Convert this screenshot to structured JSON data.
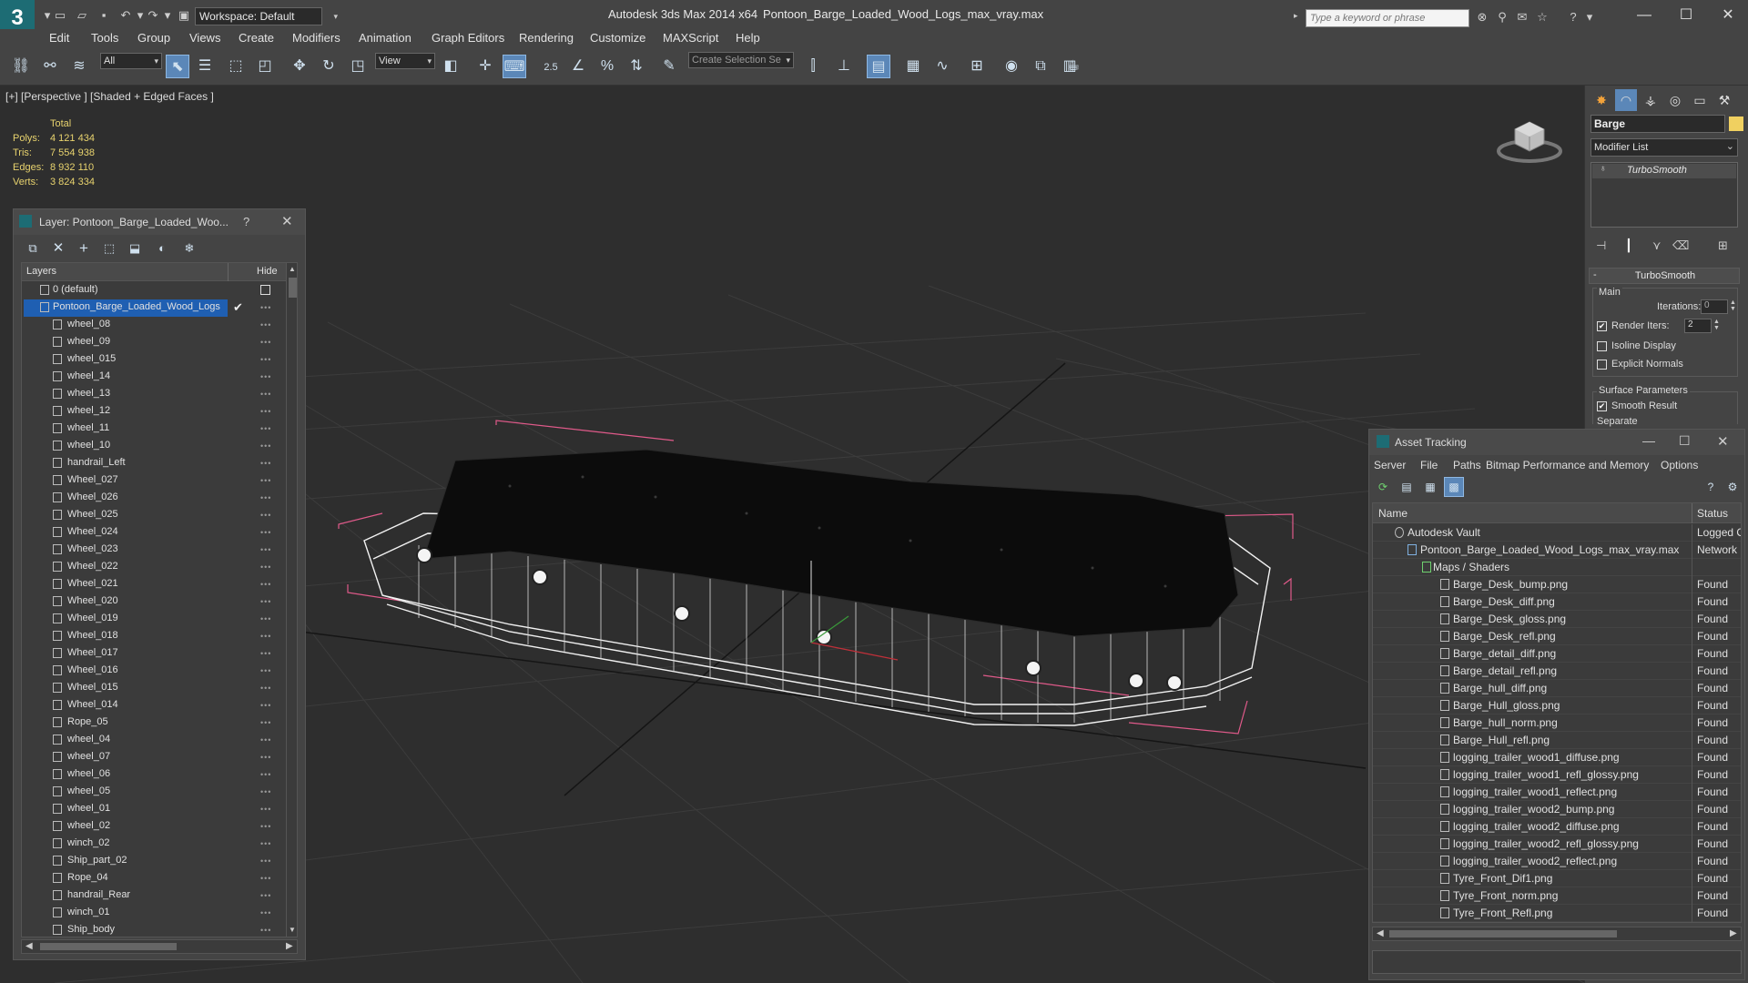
{
  "titlebar": {
    "workspace": "Workspace: Default",
    "app_title": "Autodesk 3ds Max  2014 x64",
    "file_title": "Pontoon_Barge_Loaded_Wood_Logs_max_vray.max",
    "search_placeholder": "Type a keyword or phrase"
  },
  "menu": [
    "Edit",
    "Tools",
    "Group",
    "Views",
    "Create",
    "Modifiers",
    "Animation",
    "Graph Editors",
    "Rendering",
    "Customize",
    "MAXScript",
    "Help"
  ],
  "toolbar": {
    "selection_filter": "All",
    "reference_coord": "View",
    "snap_value": "2.5",
    "named_selection_placeholder": "Create Selection Se"
  },
  "viewport": {
    "label": "[+] [Perspective ] [Shaded + Edged Faces ]",
    "stats": {
      "header": "Total",
      "rows": [
        {
          "k": "Polys:",
          "v": "4 121 434"
        },
        {
          "k": "Tris:",
          "v": "7 554 938"
        },
        {
          "k": "Edges:",
          "v": "8 932 110"
        },
        {
          "k": "Verts:",
          "v": "3 824 334"
        }
      ]
    }
  },
  "layer_panel": {
    "title": "Layer: Pontoon_Barge_Loaded_Woo...",
    "help": "?",
    "col_layers": "Layers",
    "col_hide": "Hide",
    "default_layer": "0 (default)",
    "active_layer": "Pontoon_Barge_Loaded_Wood_Logs",
    "items": [
      "wheel_08",
      "wheel_09",
      "wheel_015",
      "wheel_14",
      "wheel_13",
      "wheel_12",
      "wheel_11",
      "wheel_10",
      "handrail_Left",
      "Wheel_027",
      "Wheel_026",
      "Wheel_025",
      "Wheel_024",
      "Wheel_023",
      "Wheel_022",
      "Wheel_021",
      "Wheel_020",
      "Wheel_019",
      "Wheel_018",
      "Wheel_017",
      "Wheel_016",
      "Wheel_015",
      "Wheel_014",
      "Rope_05",
      "wheel_04",
      "wheel_07",
      "wheel_06",
      "wheel_05",
      "wheel_01",
      "wheel_02",
      "winch_02",
      "Ship_part_02",
      "Rope_04",
      "handrail_Rear",
      "winch_01",
      "Ship_body"
    ]
  },
  "command_panel": {
    "object_name": "Barge",
    "modifier_list": "Modifier List",
    "stack_item": "TurboSmooth",
    "rollout_title": "TurboSmooth",
    "main_group": "Main",
    "iterations_label": "Iterations:",
    "iterations_value": "0",
    "render_iters_label": "Render Iters:",
    "render_iters_value": "2",
    "isoline_label": "Isoline Display",
    "explicit_normals_label": "Explicit Normals",
    "surface_group": "Surface Parameters",
    "smooth_result_label": "Smooth Result",
    "separate_label": "Separate"
  },
  "asset_panel": {
    "title": "Asset Tracking",
    "menu": [
      "Server",
      "File",
      "Paths",
      "Bitmap Performance and Memory",
      "Options"
    ],
    "col_name": "Name",
    "col_status": "Status",
    "vault": {
      "name": "Autodesk Vault",
      "status": "Logged O"
    },
    "file": {
      "name": "Pontoon_Barge_Loaded_Wood_Logs_max_vray.max",
      "status": "Network"
    },
    "maps_group": "Maps / Shaders",
    "maps": [
      {
        "name": "Barge_Desk_bump.png",
        "status": "Found"
      },
      {
        "name": "Barge_Desk_diff.png",
        "status": "Found"
      },
      {
        "name": "Barge_Desk_gloss.png",
        "status": "Found"
      },
      {
        "name": "Barge_Desk_refl.png",
        "status": "Found"
      },
      {
        "name": "Barge_detail_diff.png",
        "status": "Found"
      },
      {
        "name": "Barge_detail_refl.png",
        "status": "Found"
      },
      {
        "name": "Barge_hull_diff.png",
        "status": "Found"
      },
      {
        "name": "Barge_Hull_gloss.png",
        "status": "Found"
      },
      {
        "name": "Barge_hull_norm.png",
        "status": "Found"
      },
      {
        "name": "Barge_Hull_refl.png",
        "status": "Found"
      },
      {
        "name": "logging_trailer_wood1_diffuse.png",
        "status": "Found"
      },
      {
        "name": "logging_trailer_wood1_refl_glossy.png",
        "status": "Found"
      },
      {
        "name": "logging_trailer_wood1_reflect.png",
        "status": "Found"
      },
      {
        "name": "logging_trailer_wood2_bump.png",
        "status": "Found"
      },
      {
        "name": "logging_trailer_wood2_diffuse.png",
        "status": "Found"
      },
      {
        "name": "logging_trailer_wood2_refl_glossy.png",
        "status": "Found"
      },
      {
        "name": "logging_trailer_wood2_reflect.png",
        "status": "Found"
      },
      {
        "name": "Tyre_Front_Dif1.png",
        "status": "Found"
      },
      {
        "name": "Tyre_Front_norm.png",
        "status": "Found"
      },
      {
        "name": "Tyre_Front_Refl.png",
        "status": "Found"
      }
    ]
  },
  "colors": {
    "selection_blue": "#1f5fb2",
    "stats_yellow": "#e8d36e",
    "object_color": "#f0d060",
    "bbox_pink": "#e05a8a",
    "app_teal": "#1d6c74"
  }
}
